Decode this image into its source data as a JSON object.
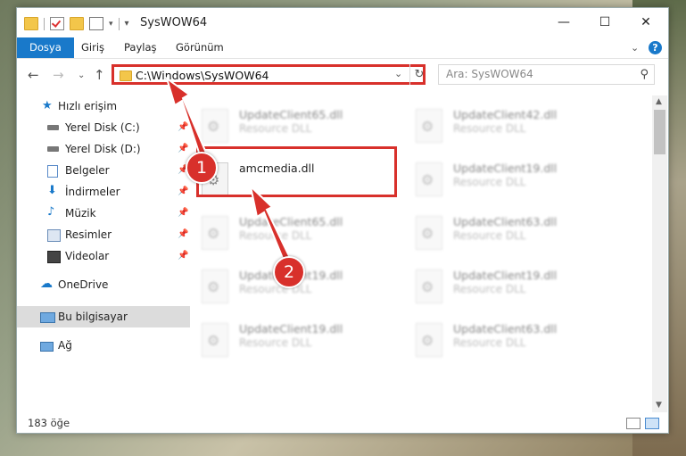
{
  "window": {
    "title": "SysWOW64",
    "controls": {
      "minimize": "—",
      "maximize": "☐",
      "close": "✕"
    }
  },
  "ribbon": {
    "tabs": [
      "Dosya",
      "Giriş",
      "Paylaş",
      "Görünüm"
    ],
    "active_tab": "Dosya",
    "help": "?"
  },
  "navigation": {
    "address_path": "C:\\Windows\\SysWOW64",
    "search_placeholder": "Ara: SysWOW64"
  },
  "sidebar": {
    "items": [
      {
        "label": "Hızlı erişim",
        "icon": "star-icon"
      },
      {
        "label": "Yerel Disk (C:)",
        "icon": "drive-icon",
        "pinned": true
      },
      {
        "label": "Yerel Disk (D:)",
        "icon": "drive-icon",
        "pinned": true
      },
      {
        "label": "Belgeler",
        "icon": "documents-icon",
        "pinned": true
      },
      {
        "label": "İndirmeler",
        "icon": "download-icon",
        "pinned": true
      },
      {
        "label": "Müzik",
        "icon": "music-icon",
        "pinned": true
      },
      {
        "label": "Resimler",
        "icon": "pictures-icon",
        "pinned": true
      },
      {
        "label": "Videolar",
        "icon": "videos-icon",
        "pinned": true
      },
      {
        "label": "OneDrive",
        "icon": "cloud-icon"
      },
      {
        "label": "Bu bilgisayar",
        "icon": "computer-icon",
        "selected": true
      },
      {
        "label": "Ağ",
        "icon": "network-icon"
      }
    ]
  },
  "files": [
    {
      "name": "UpdateClient65.dll",
      "type": "Resource DLL",
      "blurred": true
    },
    {
      "name": "UpdateClient42.dll",
      "type": "Resource DLL",
      "blurred": true
    },
    {
      "name": "amcmedia.dll",
      "type": "",
      "blurred": false,
      "highlighted": true
    },
    {
      "name": "UpdateClient19.dll",
      "type": "Resource DLL",
      "blurred": true
    },
    {
      "name": "UpdateClient65.dll",
      "type": "Resource DLL",
      "blurred": true
    },
    {
      "name": "UpdateClient63.dll",
      "type": "Resource DLL",
      "blurred": true
    },
    {
      "name": "UpdateClient19.dll",
      "type": "Resource DLL",
      "blurred": true
    },
    {
      "name": "UpdateClient19.dll",
      "type": "Resource DLL",
      "blurred": true
    },
    {
      "name": "UpdateClient19.dll",
      "type": "Resource DLL",
      "blurred": true
    },
    {
      "name": "UpdateClient63.dll",
      "type": "Resource DLL",
      "blurred": true
    }
  ],
  "status": {
    "item_count": "183 öğe"
  },
  "annotations": {
    "badge_1": "1",
    "badge_2": "2"
  },
  "colors": {
    "accent": "#1979ca",
    "highlight": "#d8302b"
  }
}
